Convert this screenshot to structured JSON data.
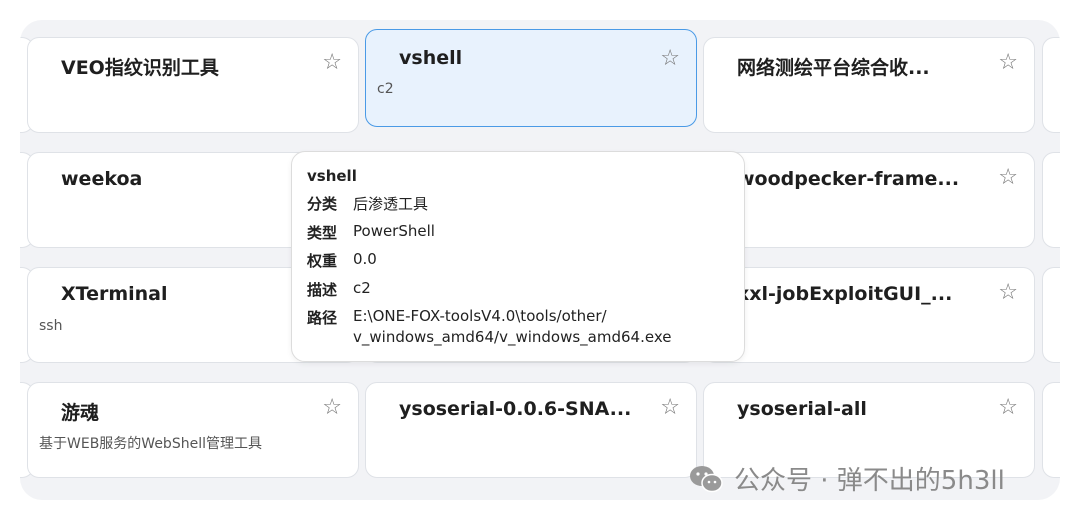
{
  "cards": [
    {
      "title": "VEO指纹识别工具",
      "desc": ""
    },
    {
      "title": "vshell",
      "desc": "c2"
    },
    {
      "title": "网络测绘平台综合收...",
      "desc": ""
    },
    {
      "title": "weekoa",
      "desc": ""
    },
    {
      "title": "woodpecker-frame...",
      "desc": ""
    },
    {
      "title": "XTerminal",
      "desc": "ssh"
    },
    {
      "title": "xxl-jobExploitGUI_...",
      "desc": ""
    },
    {
      "title": "游魂",
      "desc": "基于WEB服务的WebShell管理工具"
    },
    {
      "title": "ysoserial-0.0.6-SNA...",
      "desc": ""
    },
    {
      "title": "ysoserial-all",
      "desc": ""
    }
  ],
  "star_glyph": "☆",
  "tooltip": {
    "name": "vshell",
    "rows": [
      {
        "key": "分类",
        "value": "后渗透工具"
      },
      {
        "key": "类型",
        "value": "PowerShell"
      },
      {
        "key": "权重",
        "value": "0.0"
      },
      {
        "key": "描述",
        "value": "c2"
      },
      {
        "key": "路径",
        "value": "E:\\ONE-FOX-toolsV4.0\\tools/other/",
        "value2": "v_windows_amd64/v_windows_amd64.exe"
      }
    ]
  },
  "watermark": {
    "text": "公众号 · 弹不出的5h3ll",
    "icon": "wechat-icon"
  },
  "colors": {
    "selected_bg": "#e8f2fd",
    "selected_border": "#4a9ae6",
    "panel_bg": "#f2f3f6"
  }
}
